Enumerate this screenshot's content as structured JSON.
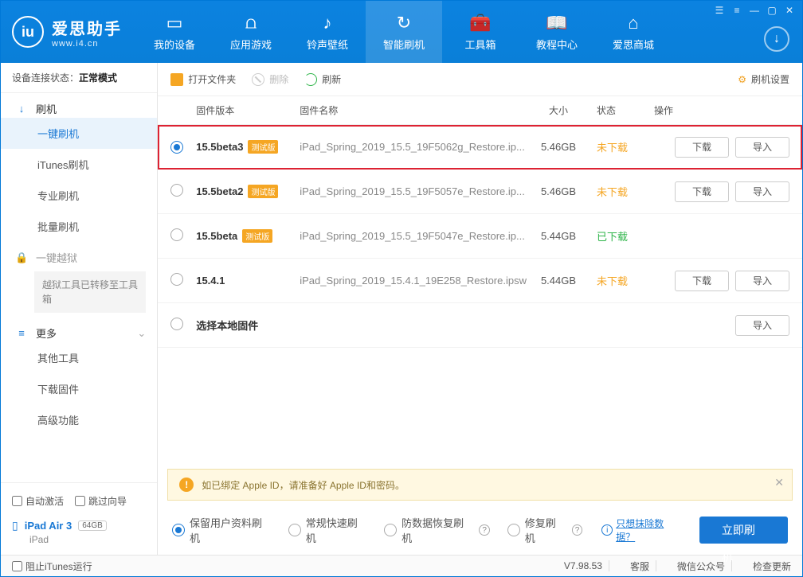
{
  "app": {
    "name": "爱思助手",
    "domain": "www.i4.cn",
    "logo_letters": "iu"
  },
  "winctrl": {
    "menu": "☰",
    "list": "≡",
    "min": "—",
    "max": "▢",
    "close": "✕"
  },
  "topnav": [
    {
      "id": "device",
      "label": "我的设备",
      "icon": "▭"
    },
    {
      "id": "apps",
      "label": "应用游戏",
      "icon": "⩍"
    },
    {
      "id": "ring",
      "label": "铃声壁纸",
      "icon": "♪"
    },
    {
      "id": "flash",
      "label": "智能刷机",
      "icon": "↻",
      "active": true
    },
    {
      "id": "toolbox",
      "label": "工具箱",
      "icon": "🧰"
    },
    {
      "id": "tutorial",
      "label": "教程中心",
      "icon": "📖"
    },
    {
      "id": "store",
      "label": "爱思商城",
      "icon": "⌂"
    }
  ],
  "download_icon": "↓",
  "conn_status": {
    "label": "设备连接状态：",
    "value": "正常模式"
  },
  "sidebar": {
    "groups": [
      {
        "id": "flash",
        "icon": "↓",
        "label": "刷机",
        "items": [
          {
            "id": "one-key",
            "label": "一键刷机",
            "active": true
          },
          {
            "id": "itunes",
            "label": "iTunes刷机"
          },
          {
            "id": "pro",
            "label": "专业刷机"
          },
          {
            "id": "batch",
            "label": "批量刷机"
          }
        ]
      },
      {
        "id": "jailbreak",
        "icon": "🔒",
        "label": "一键越狱",
        "muted": true,
        "note": "越狱工具已转移至工具箱"
      },
      {
        "id": "more",
        "icon": "≡",
        "label": "更多",
        "collapsible": true,
        "items": [
          {
            "id": "other-tools",
            "label": "其他工具"
          },
          {
            "id": "dl-fw",
            "label": "下载固件"
          },
          {
            "id": "advanced",
            "label": "高级功能"
          }
        ]
      }
    ]
  },
  "device_panel": {
    "auto_activate": "自动激活",
    "skip_guide": "跳过向导",
    "device_name": "iPad Air 3",
    "capacity": "64GB",
    "device_type": "iPad"
  },
  "toolbar": {
    "open": {
      "label": "打开文件夹",
      "color": "#f5a623"
    },
    "delete": {
      "label": "删除"
    },
    "refresh": {
      "label": "刷新",
      "color": "#2fb54a"
    },
    "settings": "刷机设置"
  },
  "columns": {
    "version": "固件版本",
    "name": "固件名称",
    "size": "大小",
    "status": "状态",
    "action": "操作"
  },
  "actions": {
    "download": "下载",
    "import": "导入"
  },
  "rows": [
    {
      "selected": true,
      "highlight": true,
      "version": "15.5beta3",
      "beta": "测试版",
      "name": "iPad_Spring_2019_15.5_19F5062g_Restore.ip...",
      "size": "5.46GB",
      "status": "未下载",
      "status_cls": "orange",
      "show_download": true
    },
    {
      "selected": false,
      "version": "15.5beta2",
      "beta": "测试版",
      "name": "iPad_Spring_2019_15.5_19F5057e_Restore.ip...",
      "size": "5.46GB",
      "status": "未下载",
      "status_cls": "orange",
      "show_download": true
    },
    {
      "selected": false,
      "version": "15.5beta",
      "beta": "测试版",
      "name": "iPad_Spring_2019_15.5_19F5047e_Restore.ip...",
      "size": "5.44GB",
      "status": "已下载",
      "status_cls": "green",
      "show_download": false
    },
    {
      "selected": false,
      "version": "15.4.1",
      "beta": null,
      "name": "iPad_Spring_2019_15.4.1_19E258_Restore.ipsw",
      "size": "5.44GB",
      "status": "未下载",
      "status_cls": "orange",
      "show_download": true
    },
    {
      "selected": false,
      "local": true,
      "version": "选择本地固件",
      "show_import_only": true
    }
  ],
  "notice": "如已绑定 Apple ID，请准备好 Apple ID和密码。",
  "flash_options": [
    {
      "id": "keep-data",
      "label": "保留用户资料刷机",
      "checked": true
    },
    {
      "id": "normal",
      "label": "常规快速刷机"
    },
    {
      "id": "anti-rec",
      "label": "防数据恢复刷机",
      "help": true
    },
    {
      "id": "repair",
      "label": "修复刷机",
      "help": true
    }
  ],
  "erase_link": "只想抹除数据？",
  "flash_now": "立即刷机",
  "statusbar": {
    "block_itunes": "阻止iTunes运行",
    "version": "V7.98.53",
    "support": "客服",
    "wechat": "微信公众号",
    "update": "检查更新"
  }
}
